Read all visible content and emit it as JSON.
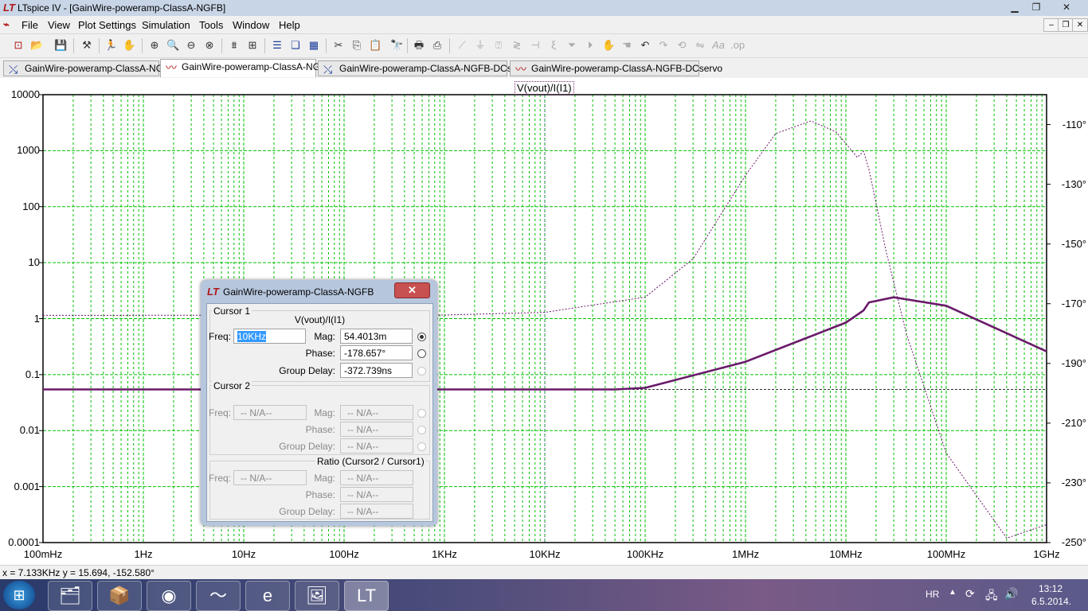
{
  "window": {
    "title": "LTspice IV - [GainWire-poweramp-ClassA-NGFB]"
  },
  "menu": [
    "File",
    "View",
    "Plot Settings",
    "Simulation",
    "Tools",
    "Window",
    "Help"
  ],
  "tabs": [
    {
      "label": "GainWire-poweramp-ClassA-NGFB",
      "kind": "schematic",
      "active": false
    },
    {
      "label": "GainWire-poweramp-ClassA-NGFB",
      "kind": "waveform",
      "active": true
    },
    {
      "label": "GainWire-poweramp-ClassA-NGFB-DCservo",
      "kind": "schematic",
      "active": false
    },
    {
      "label": "GainWire-poweramp-ClassA-NGFB-DCservo",
      "kind": "waveform",
      "active": false
    }
  ],
  "plot": {
    "trace_label": "V(vout)/I(I1)",
    "y_ticks": [
      "10000",
      "1000",
      "100",
      "10",
      "1",
      "0.1",
      "0.01",
      "0.001",
      "0.0001"
    ],
    "phase_ticks": [
      "-110°",
      "-130°",
      "-150°",
      "-170°",
      "-190°",
      "-210°",
      "-230°",
      "-250°"
    ],
    "x_ticks": [
      "100mHz",
      "1Hz",
      "10Hz",
      "100Hz",
      "1KHz",
      "10KHz",
      "100KHz",
      "1MHz",
      "10MHz",
      "100MHz",
      "1GHz"
    ],
    "colors": {
      "grid": "#00c000",
      "trace": "#6a1a6a",
      "axis": "#000000"
    }
  },
  "chart_data": {
    "type": "line",
    "x_scale": "log",
    "xlim": [
      0.1,
      1000000000
    ],
    "y_scale": "log",
    "ylim": [
      0.0001,
      10000
    ],
    "y2lim_deg": [
      -100,
      -250
    ],
    "series": [
      {
        "name": "V(vout)/I(I1)",
        "axis": "magnitude",
        "style": "solid",
        "x": [
          0.1,
          50000,
          100000,
          1000000,
          10000000,
          15000000,
          17000000,
          30000000,
          100000000,
          1000000000
        ],
        "y": [
          0.0544,
          0.0544,
          0.058,
          0.17,
          0.85,
          1.4,
          1.95,
          2.4,
          1.7,
          0.26
        ]
      },
      {
        "name": "V(vout)/I(I1)",
        "axis": "phase",
        "style": "dotted",
        "x": [
          0.1,
          1000,
          10000,
          100000,
          300000,
          1000000,
          2000000,
          4500000,
          8000000,
          13000000,
          15000000,
          17000000,
          25000000,
          40000000,
          100000000,
          400000000,
          1000000000
        ],
        "y": [
          -173.9,
          -173.8,
          -172.9,
          -167.8,
          -155,
          -127,
          -113,
          -108.8,
          -112.5,
          -121,
          -119,
          -125,
          -152,
          -180,
          -220,
          -248.5,
          -244
        ]
      }
    ]
  },
  "status": {
    "text": "x = 7.133KHz     y = 15.694, -152.580°"
  },
  "dialog": {
    "title": "GainWire-poweramp-ClassA-NGFB",
    "cursor1": {
      "group": "Cursor 1",
      "expr": "V(vout)/I(I1)",
      "freq_label": "Freq:",
      "freq": "10KHz",
      "mag_label": "Mag:",
      "mag": "54.4013m",
      "phase_label": "Phase:",
      "phase": "-178.657°",
      "gd_label": "Group Delay:",
      "gd": "-372.739ns"
    },
    "cursor2": {
      "group": "Cursor 2",
      "freq_label": "Freq:",
      "freq": "-- N/A--",
      "mag_label": "Mag:",
      "mag": "-- N/A--",
      "phase_label": "Phase:",
      "phase": "-- N/A--",
      "gd_label": "Group Delay:",
      "gd": "-- N/A--"
    },
    "ratio": {
      "group": "Ratio (Cursor2 / Cursor1)",
      "freq_label": "Freq:",
      "freq": "-- N/A--",
      "mag_label": "Mag:",
      "mag": "-- N/A--",
      "phase_label": "Phase:",
      "phase": "-- N/A--",
      "gd_label": "Group Delay:",
      "gd": "-- N/A--"
    }
  },
  "taskbar": {
    "lang": "HR",
    "time": "13:12",
    "date": "6.5.2014."
  }
}
